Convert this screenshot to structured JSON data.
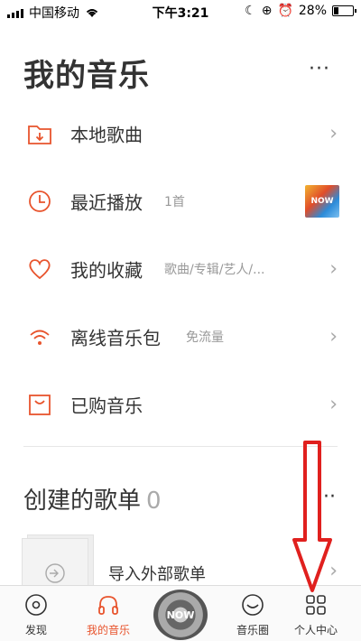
{
  "status_bar": {
    "carrier": "中国移动",
    "time": "下午3:21",
    "battery": "28%",
    "battery_level": 0.28
  },
  "header": {
    "title": "我的音乐",
    "more": "···"
  },
  "menu": [
    {
      "label": "本地歌曲",
      "sub": "",
      "icon": "folder-download-icon"
    },
    {
      "label": "最近播放",
      "sub": "1首",
      "icon": "clock-icon"
    },
    {
      "label": "我的收藏",
      "sub": "歌曲/专辑/艺人/...",
      "icon": "heart-icon"
    },
    {
      "label": "离线音乐包",
      "sub": "免流量",
      "icon": "wifi-signal-icon"
    },
    {
      "label": "已购音乐",
      "sub": "",
      "icon": "shopping-bag-icon"
    }
  ],
  "recent_thumb": {
    "text": "NOW"
  },
  "playlists": {
    "title": "创建的歌单",
    "count": "0",
    "more": "···",
    "import_label": "导入外部歌单"
  },
  "tabbar": {
    "tabs": [
      {
        "label": "发现",
        "icon": "disc-icon"
      },
      {
        "label": "我的音乐",
        "icon": "headphones-icon"
      },
      {
        "label": "",
        "icon": "now-playing-disc"
      },
      {
        "label": "音乐圈",
        "icon": "smile-circle-icon"
      },
      {
        "label": "个人中心",
        "icon": "grid-icon"
      }
    ],
    "disc_text": "NOW"
  },
  "colors": {
    "accent": "#e8542d",
    "arrow": "#e0201e"
  }
}
